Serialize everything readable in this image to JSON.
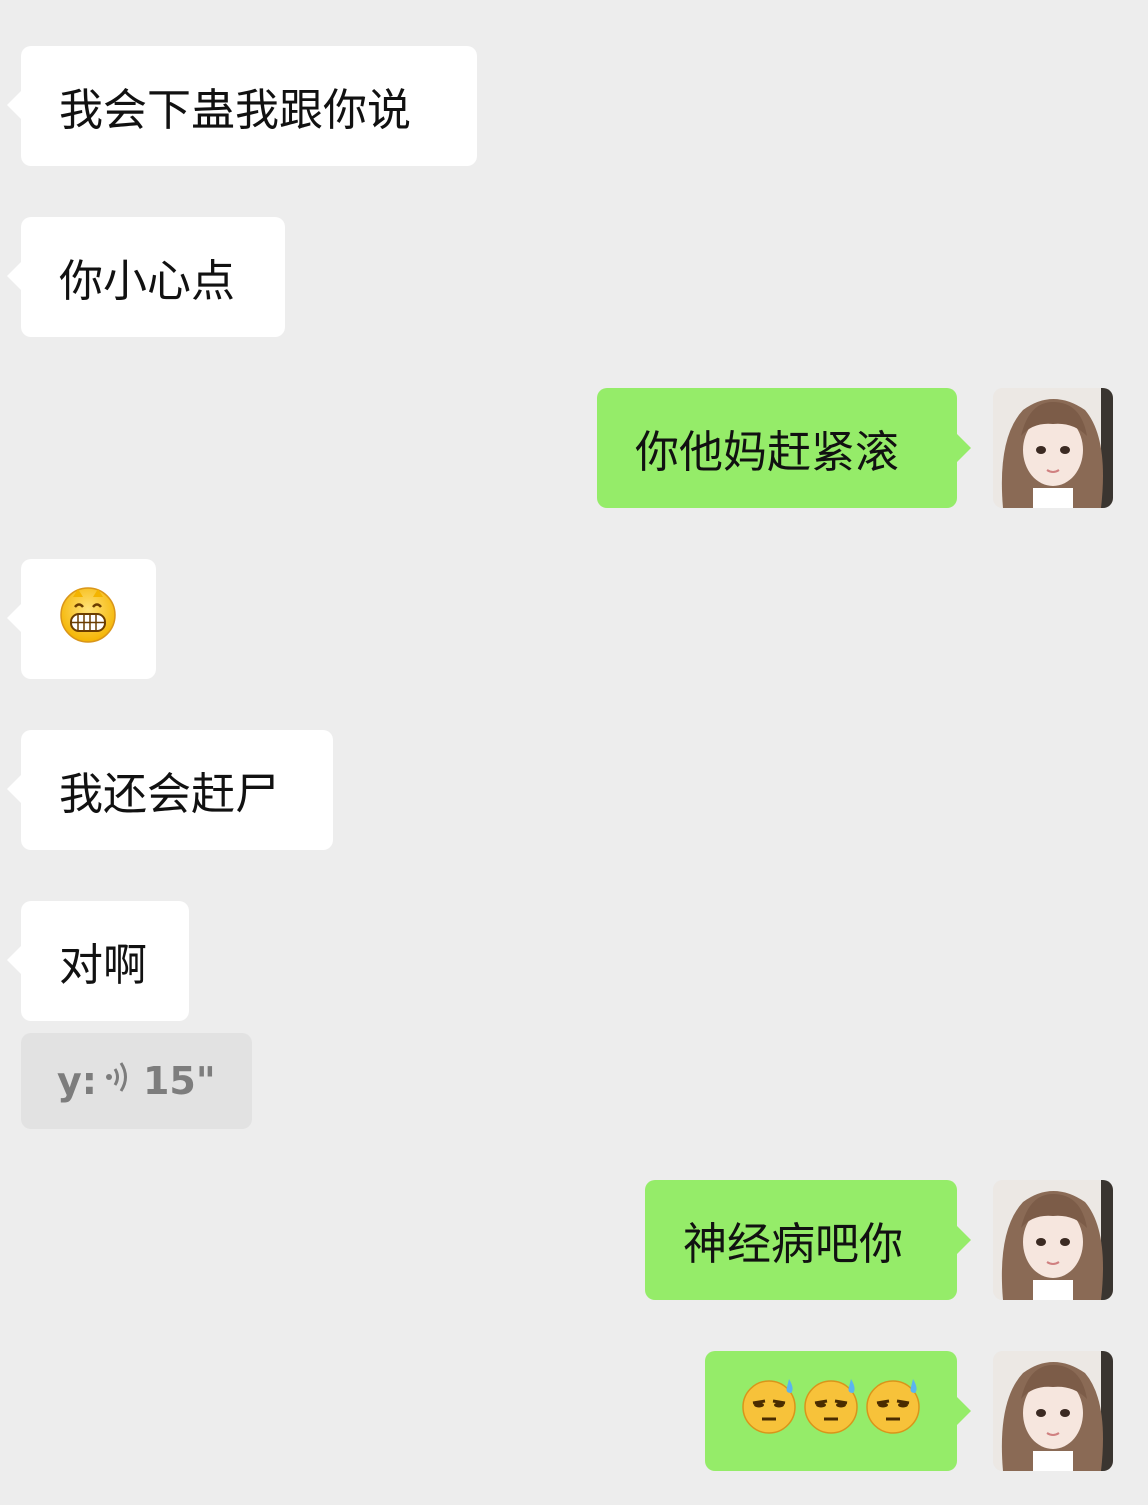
{
  "messages": [
    {
      "side": "left",
      "text": "我会下蛊我跟你说"
    },
    {
      "side": "left",
      "text": "你小心点"
    },
    {
      "side": "right",
      "text": "你他妈赶紧滚"
    },
    {
      "side": "left",
      "emoji": "grinning-face-emoji"
    },
    {
      "side": "left",
      "text": "我还会赶尸"
    },
    {
      "side": "left",
      "text": "对啊"
    },
    {
      "side": "right",
      "text": "神经病吧你"
    },
    {
      "side": "right",
      "emoji": [
        "sweat-face-emoji",
        "sweat-face-emoji",
        "sweat-face-emoji"
      ]
    }
  ],
  "voice_note": {
    "prefix": "y:",
    "icon": "voice-wave-icon",
    "duration": "15\""
  },
  "colors": {
    "background": "#ededed",
    "incoming_bubble": "#ffffff",
    "outgoing_bubble": "#95ec69",
    "voice_bubble": "#e2e2e2"
  }
}
